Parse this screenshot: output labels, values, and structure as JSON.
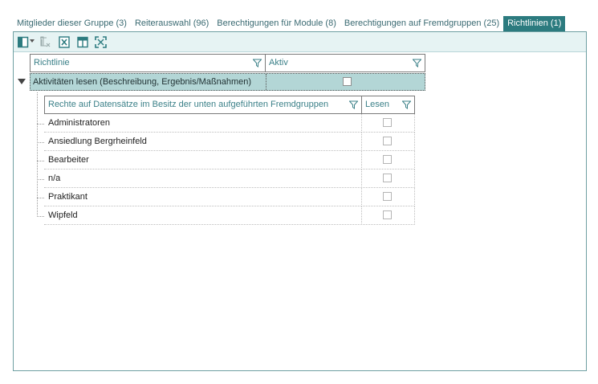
{
  "tabs": [
    {
      "label": "Mitglieder dieser Gruppe (3)",
      "active": false
    },
    {
      "label": "Reiterauswahl (96)",
      "active": false
    },
    {
      "label": "Berechtigungen für Module (8)",
      "active": false
    },
    {
      "label": "Berechtigungen auf Fremdgruppen (25)",
      "active": false
    },
    {
      "label": "Richtlinien (1)",
      "active": true
    }
  ],
  "toolbar": {
    "icons": [
      "column-chooser-icon",
      "dropdown-arrow-icon",
      "clear-filter-icon",
      "export-excel-icon",
      "layout-icon",
      "fit-columns-icon"
    ]
  },
  "grid": {
    "columns": [
      "Richtlinie",
      "Aktiv"
    ],
    "group": {
      "label": "Aktivitäten lesen (Beschreibung, Ergebnis/Maßnahmen)",
      "active": false,
      "expanded": true
    }
  },
  "subgrid": {
    "columns": [
      "Rechte auf Datensätze im Besitz der unten aufgeführten Fremdgruppen",
      "Lesen"
    ],
    "rows": [
      {
        "name": "Administratoren",
        "read": false
      },
      {
        "name": "Ansiedlung Bergrheinfeld",
        "read": false
      },
      {
        "name": "Bearbeiter",
        "read": false
      },
      {
        "name": "n/a",
        "read": false
      },
      {
        "name": "Praktikant",
        "read": false
      },
      {
        "name": "Wipfeld",
        "read": false
      }
    ]
  },
  "colors": {
    "accent": "#2c7b7f",
    "toolbar_bg": "#e6f3f3",
    "group_row": "#b3d6d6",
    "header_text": "#3b8088"
  }
}
